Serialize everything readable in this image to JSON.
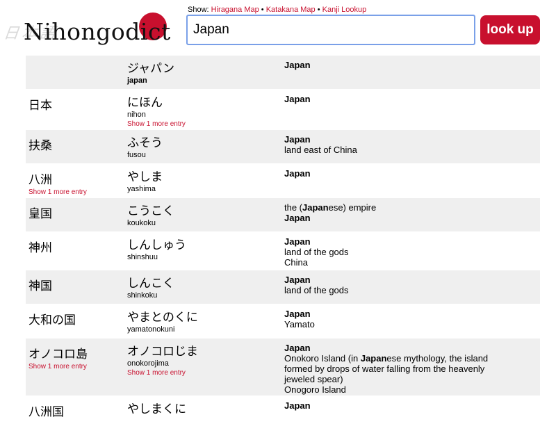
{
  "app": {
    "logo_text": "Nihongodict",
    "logo_deco": "日本語",
    "show_label": "Show:",
    "links": [
      "Hiragana Map",
      "Katakana Map",
      "Kanji Lookup"
    ],
    "separator": "•",
    "search_value": "Japan",
    "lookup_label": "look up",
    "accent_color": "#c8102e"
  },
  "entries": [
    {
      "kanji": "",
      "kanji_more": "",
      "kana": "ジャパン",
      "romaji": "japan",
      "romaji_bold": true,
      "kana_more": "",
      "defs": [
        "Japan"
      ]
    },
    {
      "kanji": "日本",
      "kanji_more": "",
      "kana": "にほん",
      "romaji": "nihon",
      "romaji_bold": false,
      "kana_more": "Show 1 more entry",
      "defs": [
        "Japan"
      ]
    },
    {
      "kanji": "扶桑",
      "kanji_more": "",
      "kana": "ふそう",
      "romaji": "fusou",
      "romaji_bold": false,
      "kana_more": "",
      "defs": [
        "Japan",
        "land east of China"
      ]
    },
    {
      "kanji": "八洲",
      "kanji_more": "Show 1 more entry",
      "kana": "やしま",
      "romaji": "yashima",
      "romaji_bold": false,
      "kana_more": "",
      "defs": [
        "Japan"
      ]
    },
    {
      "kanji": "皇国",
      "kanji_more": "",
      "kana": "こうこく",
      "romaji": "koukoku",
      "romaji_bold": false,
      "kana_more": "",
      "defs": [
        "the (Japanese) empire",
        "Japan"
      ]
    },
    {
      "kanji": "神州",
      "kanji_more": "",
      "kana": "しんしゅう",
      "romaji": "shinshuu",
      "romaji_bold": false,
      "kana_more": "",
      "defs": [
        "Japan",
        "land of the gods",
        "China"
      ]
    },
    {
      "kanji": "神国",
      "kanji_more": "",
      "kana": "しんこく",
      "romaji": "shinkoku",
      "romaji_bold": false,
      "kana_more": "",
      "defs": [
        "Japan",
        "land of the gods"
      ]
    },
    {
      "kanji": "大和の国",
      "kanji_more": "",
      "kana": "やまとのくに",
      "romaji": "yamatonokuni",
      "romaji_bold": false,
      "kana_more": "",
      "defs": [
        "Japan",
        "Yamato"
      ]
    },
    {
      "kanji": "オノコロ島",
      "kanji_more": "Show 1 more entry",
      "kana": "オノコロじま",
      "romaji": "onokorojima",
      "romaji_bold": false,
      "kana_more": "Show 1 more entry",
      "defs": [
        "Japan",
        "Onokoro Island (in Japanese mythology, the island formed by drops of water falling from the heavenly jeweled spear)",
        "Onogoro Island"
      ]
    },
    {
      "kanji": "八洲国",
      "kanji_more": "",
      "kana": "やしまくに",
      "romaji": "",
      "romaji_bold": false,
      "kana_more": "",
      "defs": [
        "Japan"
      ]
    }
  ]
}
